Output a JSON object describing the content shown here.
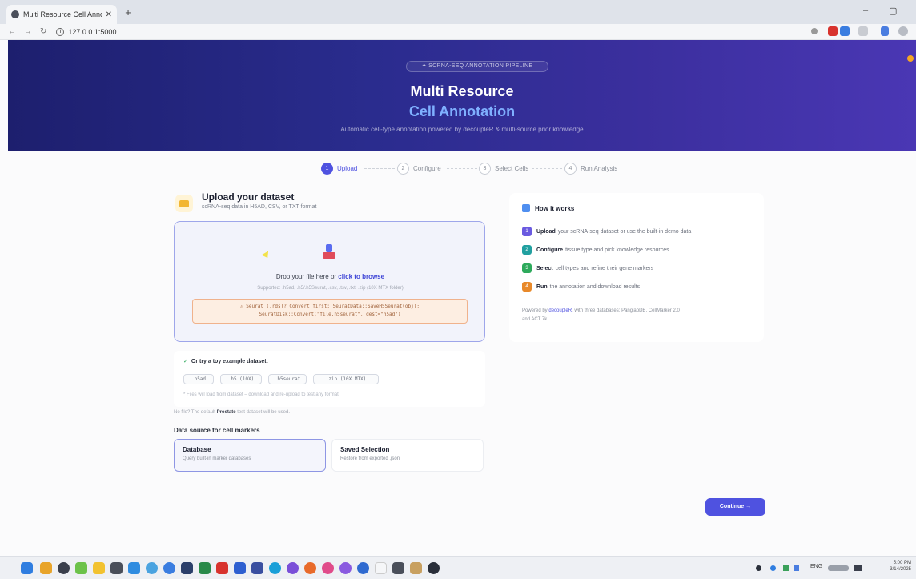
{
  "browser": {
    "tab_title": "Multi Resource Cell Anno",
    "tab_close": "✕",
    "new_tab": "+",
    "url": "127.0.0.1:5000",
    "nav_back": "←",
    "nav_forward": "→",
    "nav_reload": "↻",
    "minimize": "–",
    "restore": "▢"
  },
  "hero": {
    "badge": "✦ SCRNA-SEQ ANNOTATION PIPELINE",
    "title_line1": "Multi Resource",
    "title_line2": "Cell Annotation",
    "subtitle": "Automatic cell-type annotation powered by decoupleR & multi-source prior knowledge"
  },
  "steps": [
    {
      "num": "1",
      "label": "Upload"
    },
    {
      "num": "2",
      "label": "Configure"
    },
    {
      "num": "3",
      "label": "Select Cells"
    },
    {
      "num": "4",
      "label": "Run Analysis"
    }
  ],
  "upload": {
    "title": "Upload your dataset",
    "subtitle": "scRNA-seq data in H5AD, CSV, or TXT format",
    "drop_text": "Drop your file here or ",
    "drop_link": "click to browse",
    "supported": "Supported: .h5ad, .h5/.h5Seurat, .csv, .tsv, .txt, .zip (10X MTX folder)",
    "code_hint": "⚠ Seurat (.rds)? Convert first: SeuratData::SaveH5Seurat(obj); SeuratDisk::Convert(\"file.h5seurat\", dest=\"h5ad\")"
  },
  "examples": {
    "title": "Or try a toy example dataset:",
    "chips": [
      ".h5ad",
      ".h5 (10X)",
      ".h5seurat",
      ".zip (10X MTX)"
    ],
    "note": "* Files will load from dataset – download and re-upload to test any format",
    "no_file_prefix": "No file? The default ",
    "no_file_bold": "Prostate",
    "no_file_suffix": " test dataset will be used."
  },
  "data_source": {
    "label": "Data source for cell markers",
    "cards": [
      {
        "title": "Database",
        "desc": "Query built-in marker databases"
      },
      {
        "title": "Saved Selection",
        "desc": "Restore from exported .json"
      }
    ]
  },
  "how": {
    "title": "How it works",
    "items": [
      {
        "n": "1",
        "bold": "Upload",
        "text": "your scRNA-seq dataset or use the built-in demo data",
        "color": "#6a5ae0"
      },
      {
        "n": "2",
        "bold": "Configure",
        "text": "tissue type and pick knowledge resources",
        "color": "#22a0a0"
      },
      {
        "n": "3",
        "bold": "Select",
        "text": "cell types and refine their gene markers",
        "color": "#2eaa5c"
      },
      {
        "n": "4",
        "bold": "Run",
        "text": "the annotation and download results",
        "color": "#e8892a"
      }
    ],
    "footer_prefix": "Powered by ",
    "footer_link": "decoupleR",
    "footer_mid": ", with three databases: PanglaoDB, CellMarker 2.0",
    "footer_suffix": "and ACT 7k."
  },
  "continue_label": "Continue →",
  "taskbar": {
    "lang": "ENG",
    "time": "5:00 PM",
    "date": "3/14/2025"
  }
}
